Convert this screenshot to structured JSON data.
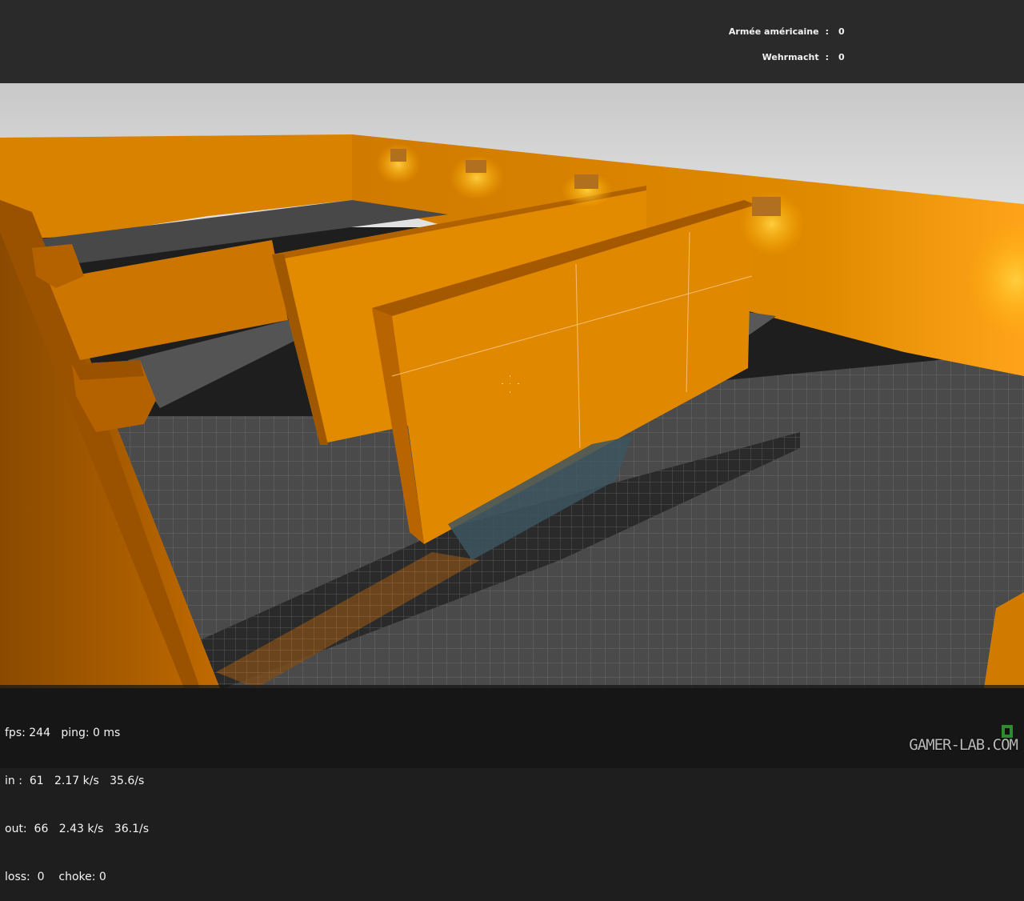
{
  "scoreboard": {
    "teams": [
      {
        "name": "Armée américaine",
        "sep": ":",
        "score": "0"
      },
      {
        "name": "Wehrmacht",
        "sep": ":",
        "score": "0"
      }
    ]
  },
  "netgraph": {
    "fps": "fps: 244   ping: 0 ms",
    "in": "in :  61   2.17 k/s   35.6/s",
    "out": "out:  66   2.43 k/s   36.1/s",
    "loss": "loss:  0    choke: 0"
  },
  "watermark": "GAMER-LAB.COM",
  "colors": {
    "wall_orange": "#e08a00",
    "wall_shadow": "#8a4a00",
    "floor_grey": "#4a4a4a",
    "sky": "#dcdcdc",
    "hud_bar": "#2a2a2a"
  }
}
